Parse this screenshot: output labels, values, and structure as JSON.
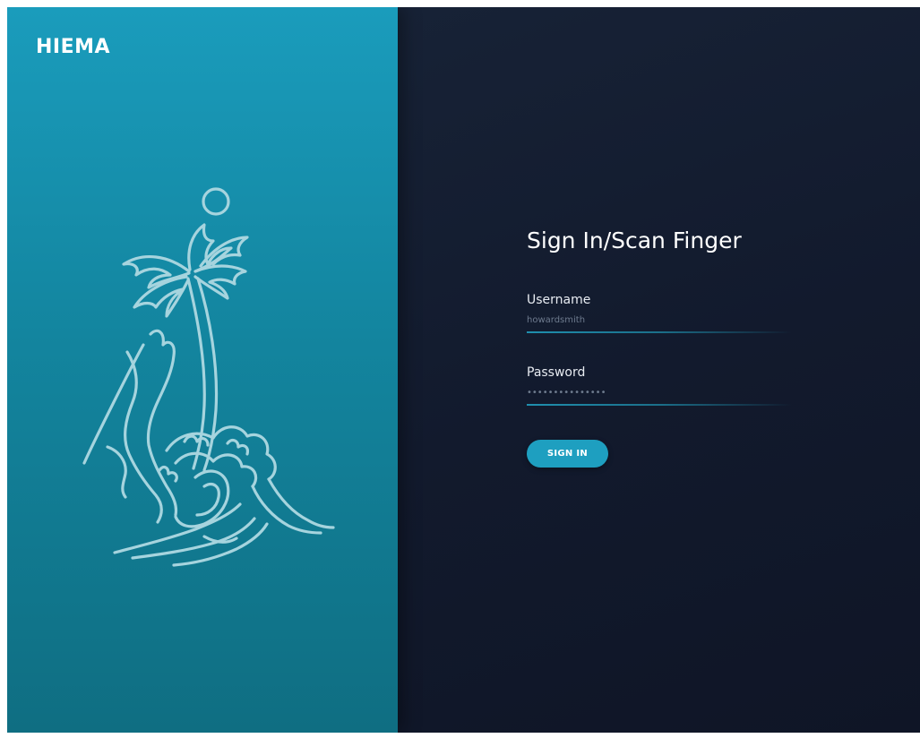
{
  "brand": {
    "name": "HIEMA"
  },
  "illustration": {
    "icon": "island-palm-wave-illustration"
  },
  "form": {
    "title": "Sign In/Scan Finger",
    "username": {
      "label": "Username",
      "value": "howardsmith"
    },
    "password": {
      "label": "Password",
      "value": "•••••••••••••••"
    },
    "submit_label": "SIGN IN"
  },
  "colors": {
    "left_panel": "#1691b0",
    "right_panel": "#131b2e",
    "accent": "#1e9fc0",
    "illustration_stroke": "#a6d4de"
  }
}
